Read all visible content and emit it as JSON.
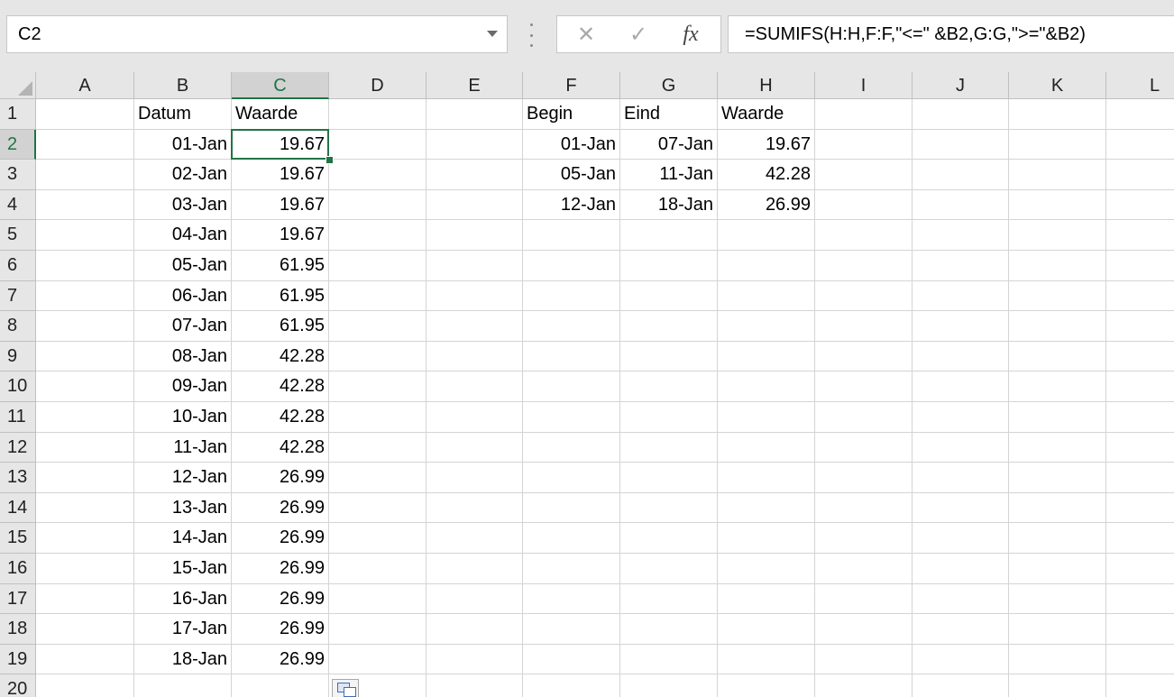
{
  "name_box": {
    "value": "C2"
  },
  "formula_bar": {
    "cancel_glyph": "✕",
    "enter_glyph": "✓",
    "fx_label": "fx",
    "formula": "=SUMIFS(H:H,F:F,\"<=\" &B2,G:G,\">=\"&B2)"
  },
  "columns": [
    "A",
    "B",
    "C",
    "D",
    "E",
    "F",
    "G",
    "H",
    "I",
    "J",
    "K",
    "L"
  ],
  "selected_column": "C",
  "rows": [
    "1",
    "2",
    "3",
    "4",
    "5",
    "6",
    "7",
    "8",
    "9",
    "10",
    "11",
    "12",
    "13",
    "14",
    "15",
    "16",
    "17",
    "18",
    "19",
    "20"
  ],
  "selected_row": "2",
  "cells": {
    "B1": "Datum",
    "C1": "Waarde",
    "B2": "01-Jan",
    "C2": "19.67",
    "B3": "02-Jan",
    "C3": "19.67",
    "B4": "03-Jan",
    "C4": "19.67",
    "B5": "04-Jan",
    "C5": "19.67",
    "B6": "05-Jan",
    "C6": "61.95",
    "B7": "06-Jan",
    "C7": "61.95",
    "B8": "07-Jan",
    "C8": "61.95",
    "B9": "08-Jan",
    "C9": "42.28",
    "B10": "09-Jan",
    "C10": "42.28",
    "B11": "10-Jan",
    "C11": "42.28",
    "B12": "11-Jan",
    "C12": "42.28",
    "B13": "12-Jan",
    "C13": "26.99",
    "B14": "13-Jan",
    "C14": "26.99",
    "B15": "14-Jan",
    "C15": "26.99",
    "B16": "15-Jan",
    "C16": "26.99",
    "B17": "16-Jan",
    "C17": "26.99",
    "B18": "17-Jan",
    "C18": "26.99",
    "B19": "18-Jan",
    "C19": "26.99",
    "F1": "Begin",
    "G1": "Eind",
    "H1": "Waarde",
    "F2": "01-Jan",
    "G2": "07-Jan",
    "H2": "19.67",
    "F3": "05-Jan",
    "G3": "11-Jan",
    "H3": "42.28",
    "F4": "12-Jan",
    "G4": "18-Jan",
    "H4": "26.99"
  },
  "active_cell": "C2",
  "colors": {
    "accent": "#217346",
    "header_bg": "#e6e6e6",
    "grid_line": "#d4d4d4"
  }
}
